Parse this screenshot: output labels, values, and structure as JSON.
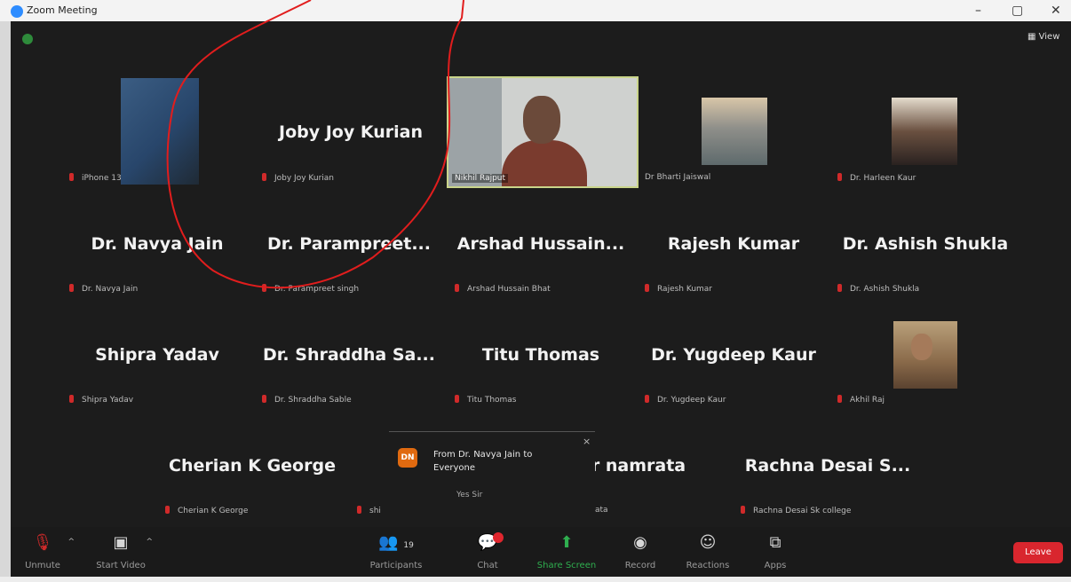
{
  "window": {
    "title": "Zoom Meeting",
    "view_label": "View"
  },
  "accent": "#2d8cff",
  "big_names": [
    {
      "name": "Joby Joy Kurian"
    },
    {
      "name": "Dr. Navya Jain"
    },
    {
      "name": "Dr.  Parampreet..."
    },
    {
      "name": "Arshad  Hussain..."
    },
    {
      "name": "Rajesh Kumar"
    },
    {
      "name": "Dr. Ashish Shukla"
    },
    {
      "name": "Shipra Yadav"
    },
    {
      "name": "Dr. Shraddha  Sa..."
    },
    {
      "name": "Titu Thomas"
    },
    {
      "name": "Dr. Yugdeep Kaur"
    },
    {
      "name": "Cherian K George"
    },
    {
      "name": "r namrata"
    },
    {
      "name": "Rachna  Desai  S..."
    }
  ],
  "labels": [
    "iPhone 13",
    "Joby Joy Kurian",
    "Nikhil Rajput",
    "Dr Bharti Jaiswal",
    "Dr. Harleen Kaur",
    "Dr. Navya Jain",
    "Dr. Parampreet singh",
    "Arshad Hussain Bhat",
    "Rajesh Kumar",
    "Dr. Ashish Shukla",
    "Shipra Yadav",
    "Dr. Shraddha Sable",
    "Titu Thomas",
    "Dr. Yugdeep Kaur",
    "Akhil Raj",
    "Cherian K George",
    "shi",
    "ata",
    "Rachna Desai Sk college"
  ],
  "chat": {
    "avatar": "DN",
    "from": "From Dr. Navya Jain to Everyone",
    "message": "Yes Sir",
    "close": "×"
  },
  "toolbar": {
    "unmute": "Unmute",
    "start_video": "Start Video",
    "participants": "Participants",
    "participants_count": "19",
    "chat": "Chat",
    "share_screen": "Share Screen",
    "record": "Record",
    "reactions": "Reactions",
    "apps": "Apps",
    "leave": "Leave"
  }
}
